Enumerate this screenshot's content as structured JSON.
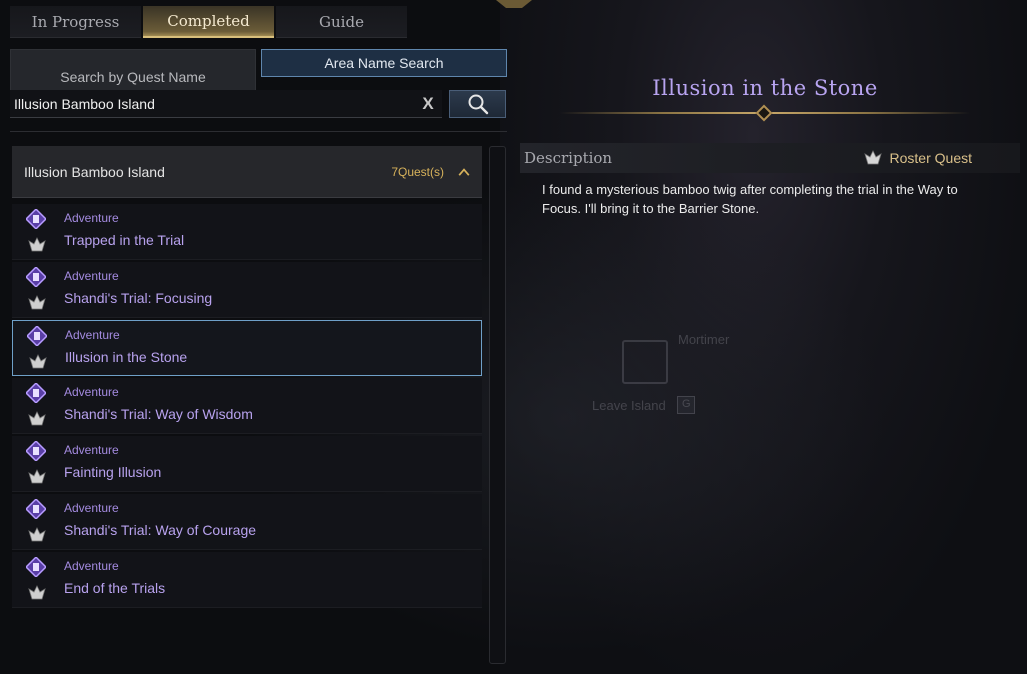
{
  "tabs": [
    {
      "label": "In Progress",
      "active": false
    },
    {
      "label": "Completed",
      "active": true
    },
    {
      "label": "Guide",
      "active": false
    }
  ],
  "search_modes": {
    "quest_name": "Search by Quest Name",
    "area_name": "Area Name Search",
    "selected": "area_name"
  },
  "search": {
    "value": "Illusion Bamboo Island",
    "clear_icon": "close-x-icon",
    "search_icon": "magnifier-icon"
  },
  "group": {
    "title": "Illusion Bamboo Island",
    "count": "7Quest(s)",
    "expanded": true
  },
  "quests": [
    {
      "type": "Adventure",
      "name": "Trapped in the Trial",
      "selected": false
    },
    {
      "type": "Adventure",
      "name": "Shandi's Trial: Focusing",
      "selected": false
    },
    {
      "type": "Adventure",
      "name": "Illusion in the Stone",
      "selected": true
    },
    {
      "type": "Adventure",
      "name": "Shandi's Trial: Way of Wisdom",
      "selected": false
    },
    {
      "type": "Adventure",
      "name": "Fainting Illusion",
      "selected": false
    },
    {
      "type": "Adventure",
      "name": "Shandi's Trial: Way of Courage",
      "selected": false
    },
    {
      "type": "Adventure",
      "name": "End of the Trials",
      "selected": false
    }
  ],
  "detail": {
    "title": "Illusion in the Stone",
    "description_label": "Description",
    "roster_label": "Roster Quest",
    "description": "I found a mysterious bamboo twig after completing the trial in the Way to Focus. I'll bring it to the Barrier Stone."
  },
  "background": {
    "npc_name": "Mortimer",
    "leave_label": "Leave Island",
    "leave_key": "G"
  },
  "colors": {
    "accent_gold": "#d7b25b",
    "quest_purple": "#b8a2ee",
    "selected_border": "#6fa0c8",
    "area_button": "#1e2f44"
  }
}
